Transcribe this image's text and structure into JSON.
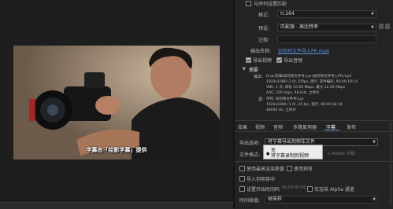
{
  "preview": {
    "subtitle": "字幕由「绘影字幕」提供"
  },
  "top_partial": {
    "match_sequence_label": "与序列设置匹配"
  },
  "format": {
    "label": "格式:",
    "value": "H.264"
  },
  "preset": {
    "label": "预设:",
    "value": "匹配源 - 高比特率"
  },
  "comment": {
    "label": "注释:",
    "value": ""
  },
  "output_name": {
    "label": "输出名称:",
    "value": "如何将文件导入PR.mp4"
  },
  "export_video": "导出视频",
  "export_audio": "导出音频",
  "summary": {
    "title": "摘要",
    "output_label": "输出:",
    "output_lines": [
      "D:\\pr剪辑\\如何将文件导入pr\\如何将文件导入PR.mp4",
      "1920x1080 (1.0), 25fps, 逐行, 软件编码, 00:00:18:14",
      "VBR, 1 次, 目标 10.00 Mbps, 最大 12.00 Mbps",
      "AAC, 320 kbps, 48 kHz, 立体声"
    ],
    "source_label": "源:",
    "source_lines": [
      "序列, 如何将文件导入pr",
      "1920x1080 (1.0), 25 fps, 逐行, 00:00:18:14",
      "48000 Hz, 立体声"
    ]
  },
  "tabs": [
    "效果",
    "视频",
    "音频",
    "多路复用器",
    "字幕",
    "发布"
  ],
  "active_tab_index": 4,
  "caption_export": {
    "label": "导出选项:",
    "value": "将字幕导出到侧车文件",
    "menu_options": [
      "无",
      "将字幕录制到视频"
    ],
    "selected_menu_index": 1
  },
  "file_format": {
    "label": "文件格式:",
    "hint": "s (Adobe 字幕)"
  },
  "bottom_options": {
    "max_render_quality": "使用最高渲染质量",
    "use_previews": "使用预览",
    "import_into_project": "导入到项目中",
    "set_start_timecode": "设置开始时间码",
    "timecode_value": "00:00:00:00",
    "render_alpha_only": "仅渲染 Alpha 通道",
    "time_interpolation_label": "时间插值:",
    "time_interpolation_value": "帧采样"
  },
  "colors": {
    "background": "#232323",
    "link_blue": "#5b8ed8",
    "menu_bg": "#ececec"
  },
  "icons": [
    "chevron-down-icon",
    "checkbox-icon",
    "expand-triangle-icon"
  ]
}
